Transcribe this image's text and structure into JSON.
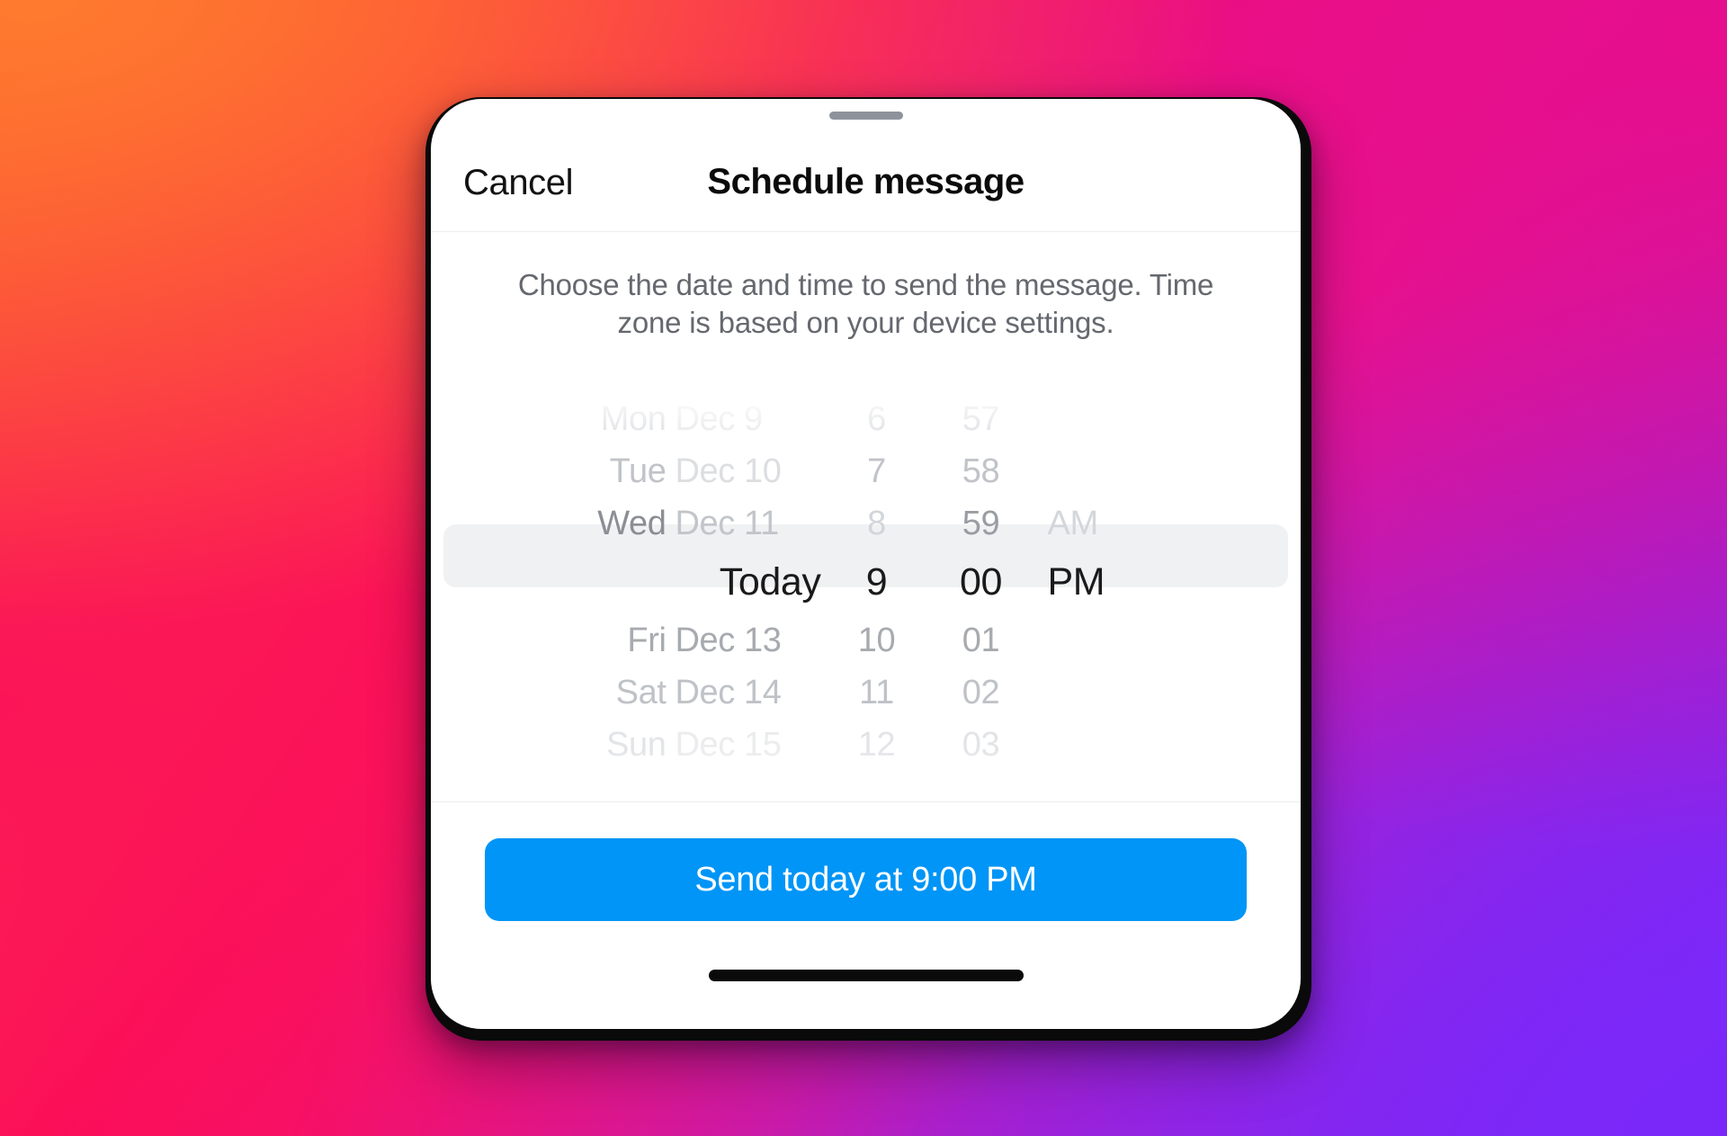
{
  "background": {
    "gradient_stops": [
      "#FA5A28",
      "#FB0A5A",
      "#E60E8C",
      "#9B22D8",
      "#7A28FA"
    ]
  },
  "device": {
    "drag_handle": "drag-handle",
    "home_indicator": "home-indicator"
  },
  "sheet": {
    "cancel_label": "Cancel",
    "title": "Schedule message",
    "description": "Choose the date and time to send the message. Time zone is based on your device settings.",
    "accent_color": "#0095F6"
  },
  "picker": {
    "selected_index": 3,
    "rows": [
      {
        "dow": "Mon",
        "date": "Dec 9",
        "hour": "6",
        "minute": "57",
        "ampm": ""
      },
      {
        "dow": "Tue",
        "date": "Dec 10",
        "hour": "7",
        "minute": "58",
        "ampm": ""
      },
      {
        "dow": "Wed",
        "date": "Dec 11",
        "hour": "8",
        "minute": "59",
        "ampm": "AM"
      },
      {
        "dow": "",
        "date": "Today",
        "hour": "9",
        "minute": "00",
        "ampm": "PM"
      },
      {
        "dow": "Fri",
        "date": "Dec 13",
        "hour": "10",
        "minute": "01",
        "ampm": ""
      },
      {
        "dow": "Sat",
        "date": "Dec 14",
        "hour": "11",
        "minute": "02",
        "ampm": ""
      },
      {
        "dow": "Sun",
        "date": "Dec 15",
        "hour": "12",
        "minute": "03",
        "ampm": ""
      }
    ],
    "selected_value": {
      "date": "Today",
      "hour": "9",
      "minute": "00",
      "ampm": "PM"
    }
  },
  "footer": {
    "send_label": "Send today at 9:00 PM"
  }
}
